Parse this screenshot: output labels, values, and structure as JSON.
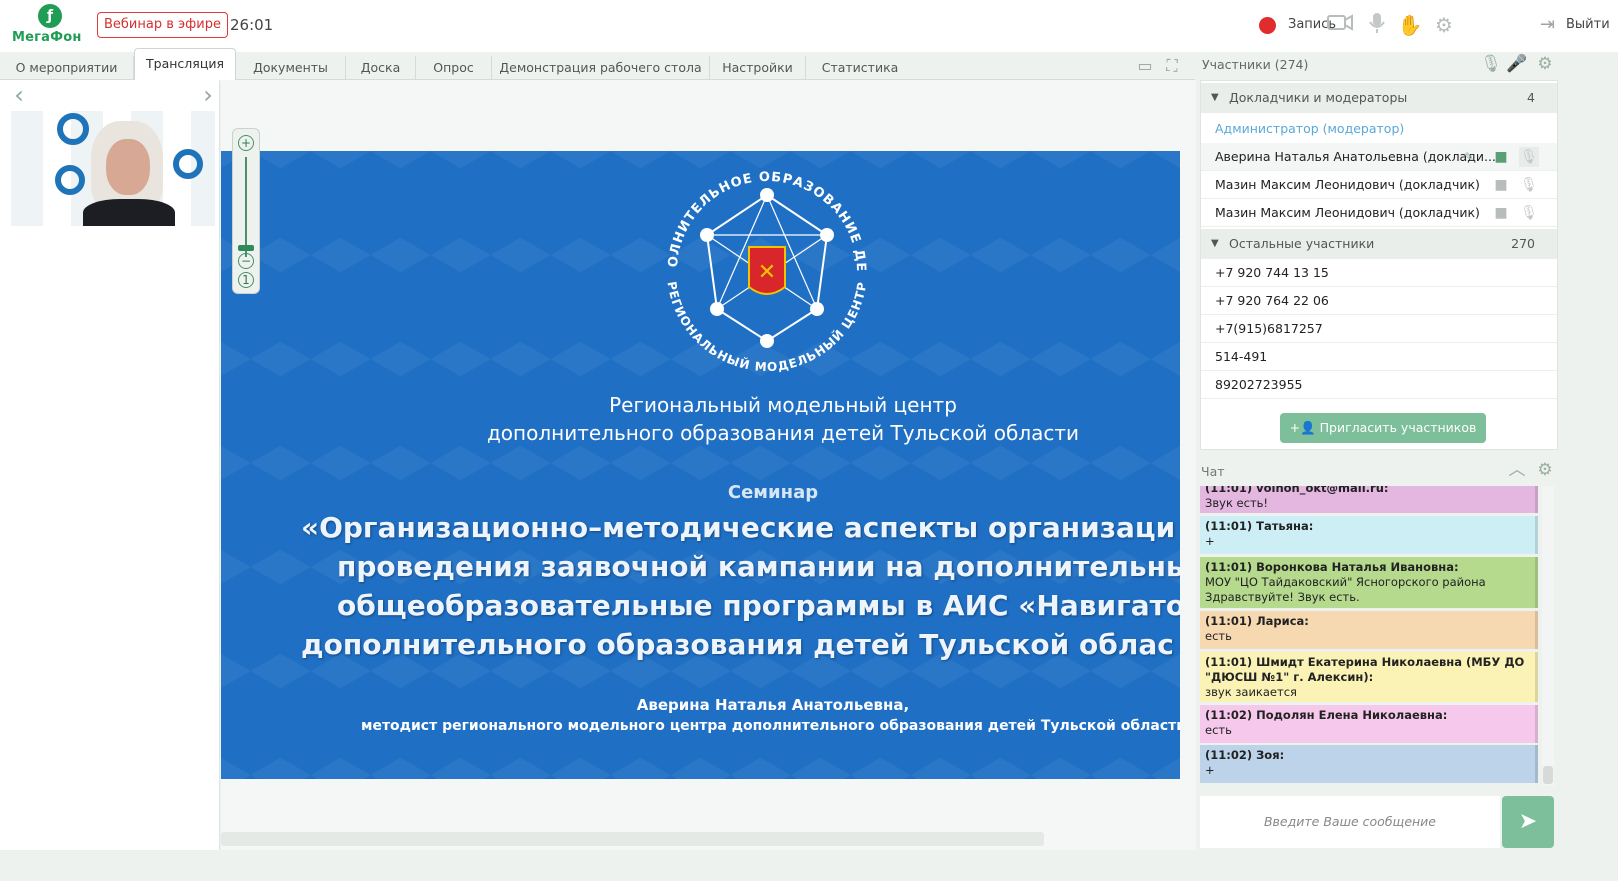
{
  "brand": {
    "logo_text": "МегаФон",
    "logo_icon": "megafon-logo-icon",
    "color": "#1f9d55"
  },
  "header": {
    "live_badge": "Вебинар в эфире",
    "timer": "26:01",
    "record_label": "Запись",
    "exit_label": "Выйти",
    "icons": [
      "camera-icon",
      "microphone-icon",
      "raise-hand-icon",
      "settings-icon",
      "exit-icon"
    ]
  },
  "tabs": [
    {
      "label": "О мероприятии",
      "active": false
    },
    {
      "label": "Трансляция",
      "active": true
    },
    {
      "label": "Документы",
      "active": false
    },
    {
      "label": "Доска",
      "active": false
    },
    {
      "label": "Опрос",
      "active": false
    },
    {
      "label": "Демонстрация рабочего стола",
      "active": false
    },
    {
      "label": "Настройки",
      "active": false
    },
    {
      "label": "Статистика",
      "active": false
    }
  ],
  "slide": {
    "org_line1": "Региональный модельный центр",
    "org_line2": "дополнительного образования детей Тульской области",
    "seminar_label": "Семинар",
    "title_lines": [
      "«Организационно–методические аспекты организаци",
      "проведения заявочной кампании на дополнительны",
      "общеобразовательные программы в АИС «Навигато",
      "дополнительного образования детей Тульской облас"
    ],
    "author": "Аверина Наталья Анатольевна,",
    "author_role": "методист регионального модельного центра дополнительного образования детей Тульской области",
    "emblem_top_text": "ДОПОЛНИТЕЛЬНОЕ ОБРАЗОВАНИЕ ДЕТЕЙ",
    "emblem_bottom_text": "РЕГИОНАЛЬНЫЙ МОДЕЛЬНЫЙ ЦЕНТР",
    "background_color": "#1f6fc4"
  },
  "participants": {
    "header": "Участники (274)",
    "speakers_group": {
      "label": "Докладчики и модераторы",
      "count": "4"
    },
    "admin_label": "Администратор (модератор)",
    "speakers": [
      "Аверина Наталья Анатольевна (доклади...",
      "Мазин Максим Леонидович (докладчик)",
      "Мазин Максим Леонидович (докладчик)"
    ],
    "others_group": {
      "label": "Остальные участники",
      "count": "270"
    },
    "others": [
      "+7 920 744 13 15",
      "+7 920 764 22 06",
      "+7(915)6817257",
      "514-491",
      "89202723955"
    ],
    "invite_label": "Пригласить участников"
  },
  "chat": {
    "title": "Чат",
    "messages": [
      {
        "who": "(11:01) volhon_okt@mail.ru:",
        "text": "Звук есть!",
        "color": "#e3b7e0"
      },
      {
        "who": "(11:01) Татьяна:",
        "text": "+",
        "color": "#cdeef5"
      },
      {
        "who": "(11:01) Воронкова Наталья Ивановна:",
        "text": "МОУ \"ЦО Тайдаковский\" Ясногорского района Здравствуйте! Звук есть.",
        "color": "#b5da8e"
      },
      {
        "who": "(11:01) Лариса:",
        "text": "есть",
        "color": "#f6d9b0"
      },
      {
        "who": "(11:01) Шмидт Екатерина Николаевна (МБУ ДО \"ДЮСШ №1\" г. Алексин):",
        "text": "звук заикается",
        "color": "#fbf3b6"
      },
      {
        "who": "(11:02) Подолян Елена Николаевна:",
        "text": "есть",
        "color": "#f6c9ec"
      },
      {
        "who": "(11:02) Зоя:",
        "text": "+",
        "color": "#bcd3ea"
      }
    ],
    "input_placeholder": "Введите Ваше сообщение"
  }
}
